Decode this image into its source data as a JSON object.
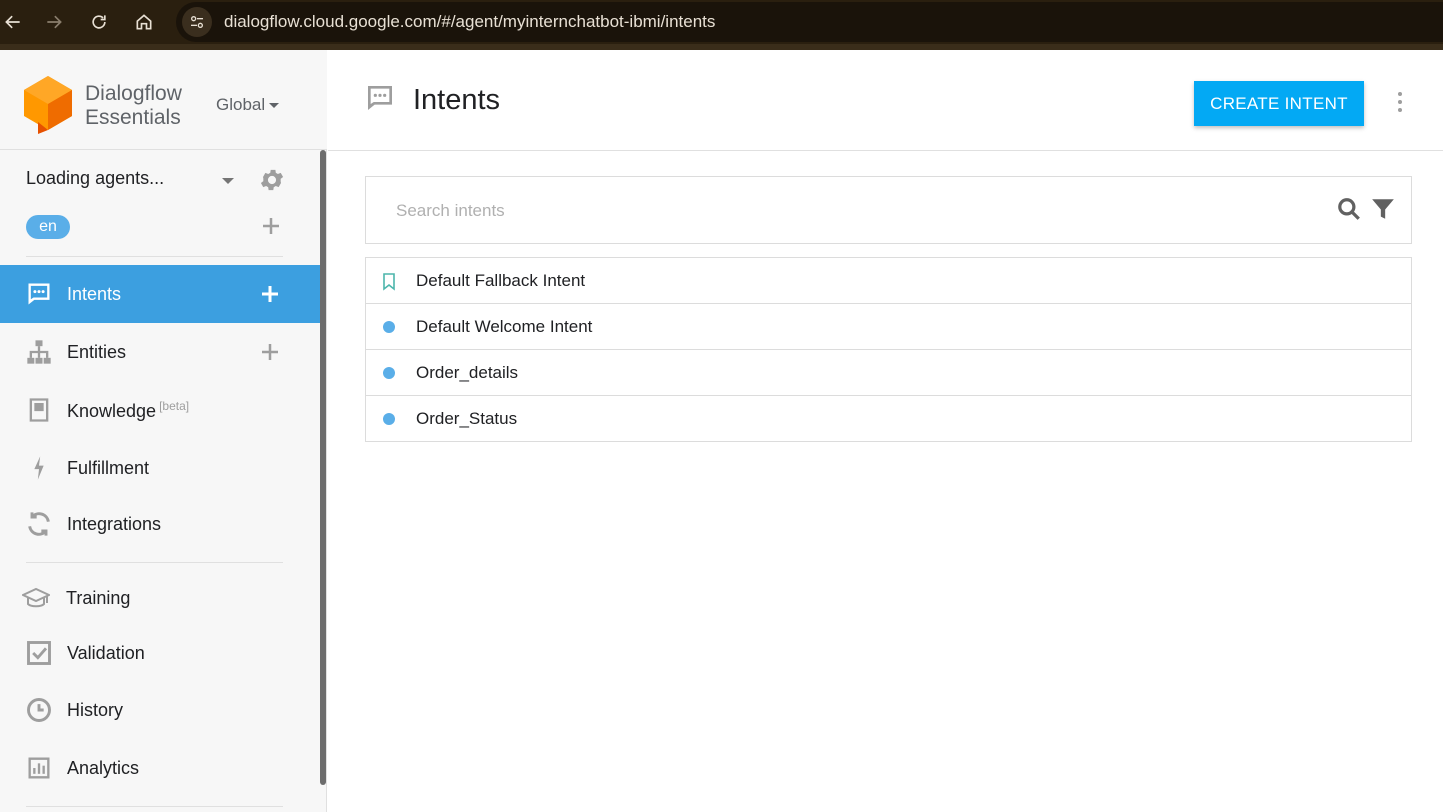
{
  "browser": {
    "url": "dialogflow.cloud.google.com/#/agent/myinternchatbot-ibmi/intents"
  },
  "brand": {
    "line1": "Dialogflow",
    "line2": "Essentials",
    "region": "Global"
  },
  "agent": {
    "name": "Loading agents...",
    "language": "en"
  },
  "sidebar": {
    "items": [
      {
        "label": "Intents",
        "icon": "chat-icon",
        "active": true
      },
      {
        "label": "Entities",
        "icon": "hierarchy-icon"
      },
      {
        "label": "Knowledge",
        "icon": "book-icon",
        "badge": "[beta]"
      },
      {
        "label": "Fulfillment",
        "icon": "lightning-icon"
      },
      {
        "label": "Integrations",
        "icon": "sync-icon"
      },
      {
        "label": "Training",
        "icon": "graduation-cap-icon"
      },
      {
        "label": "Validation",
        "icon": "checkbox-icon"
      },
      {
        "label": "History",
        "icon": "clock-icon"
      },
      {
        "label": "Analytics",
        "icon": "bar-chart-icon"
      }
    ]
  },
  "header": {
    "title": "Intents",
    "create_label": "CREATE INTENT"
  },
  "search": {
    "placeholder": "Search intents"
  },
  "intents": [
    {
      "name": "Default Fallback Intent",
      "marker": "bookmark"
    },
    {
      "name": "Default Welcome Intent",
      "marker": "dot"
    },
    {
      "name": "Order_details",
      "marker": "dot"
    },
    {
      "name": "Order_Status",
      "marker": "dot"
    }
  ],
  "colors": {
    "accent": "#03a9f4",
    "active_nav": "#3c9fe0",
    "dot": "#5aaee8",
    "logo_orange": "#ff9800"
  }
}
